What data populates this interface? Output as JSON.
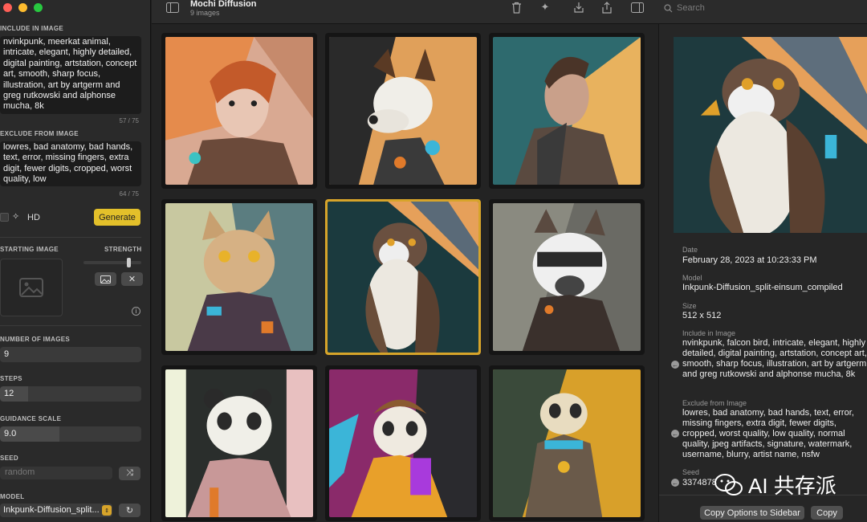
{
  "window": {
    "title": "Mochi Diffusion",
    "subtitle": "9 images"
  },
  "search": {
    "placeholder": "Search"
  },
  "sidebar": {
    "include_label": "INCLUDE IN IMAGE",
    "include_text": "nvinkpunk, meerkat animal, intricate, elegant, highly detailed, digital painting, artstation, concept art, smooth, sharp focus, illustration, art by artgerm and greg rutkowski and alphonse mucha, 8k",
    "include_count": "57 / 75",
    "exclude_label": "EXCLUDE FROM IMAGE",
    "exclude_text": "lowres, bad anatomy, bad hands, text, error, missing fingers, extra digit, fewer digits, cropped, worst quality, low",
    "exclude_count": "64 / 75",
    "hd_label": "HD",
    "generate_label": "Generate",
    "starting_image_label": "STARTING IMAGE",
    "strength_label": "STRENGTH",
    "strength_value": 0.78,
    "num_images_label": "NUMBER OF IMAGES",
    "num_images": "9",
    "steps_label": "STEPS",
    "steps": "12",
    "steps_fill": 0.2,
    "guidance_label": "GUIDANCE SCALE",
    "guidance": "9.0",
    "guidance_fill": 0.42,
    "seed_label": "SEED",
    "seed_placeholder": "random",
    "model_label": "MODEL",
    "model_value": "Inkpunk-Diffusion_split..."
  },
  "detail": {
    "date_label": "Date",
    "date": "February 28, 2023 at 10:23:33 PM",
    "model_label": "Model",
    "model": "Inkpunk-Diffusion_split-einsum_compiled",
    "size_label": "Size",
    "size": "512 x 512",
    "include_label": "Include in Image",
    "include": "nvinkpunk, falcon bird, intricate, elegant, highly detailed, digital painting, artstation, concept art, smooth, sharp focus, illustration, art by artgerm and greg rutkowski and alphonse mucha, 8k",
    "exclude_label": "Exclude from Image",
    "exclude": "lowres, bad anatomy, bad hands, text, error, missing fingers, extra digit, fewer digits, cropped, worst quality, low quality, normal quality, jpeg artifacts, signature, watermark, username, blurry, artist name, nsfw",
    "seed_label": "Seed",
    "seed": "3374878",
    "copy_options_label": "Copy Options to Sidebar",
    "copy_label": "Copy"
  },
  "watermark": "AI 共存派",
  "colors": {
    "accent": "#d7a42a",
    "generate": "#e3c02a",
    "close": "#ff5f57",
    "minimize": "#febc2e",
    "zoom": "#28c840"
  },
  "gallery": [
    {
      "subject": "woman"
    },
    {
      "subject": "dog"
    },
    {
      "subject": "man"
    },
    {
      "subject": "cat"
    },
    {
      "subject": "falcon",
      "selected": true
    },
    {
      "subject": "raccoon"
    },
    {
      "subject": "panda"
    },
    {
      "subject": "ferret"
    },
    {
      "subject": "meerkat"
    }
  ]
}
